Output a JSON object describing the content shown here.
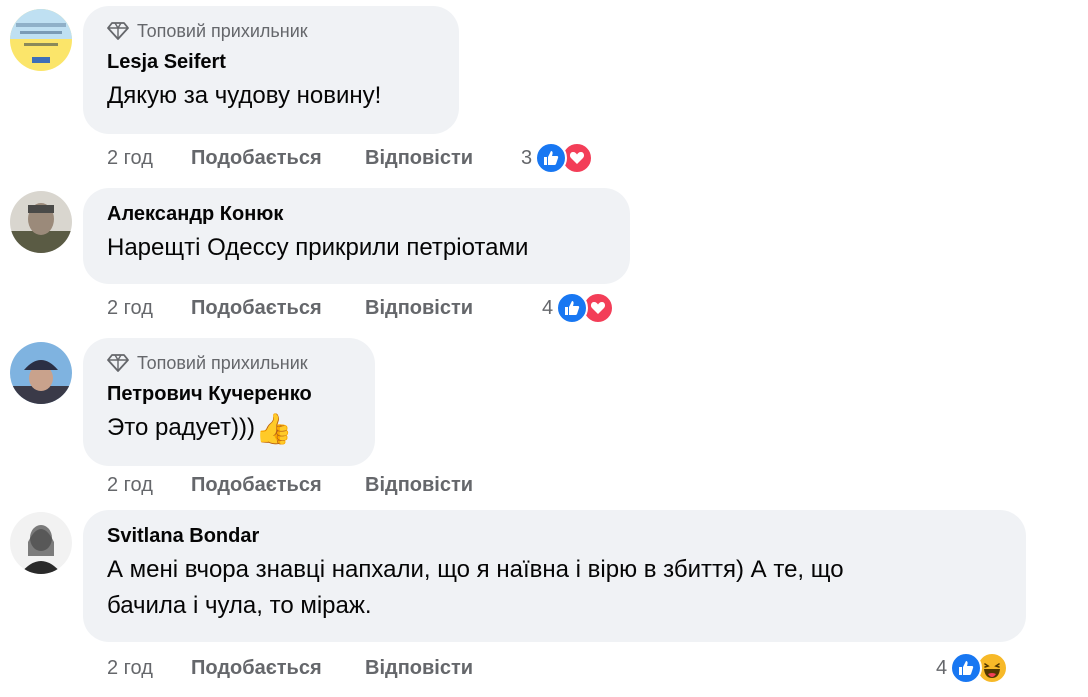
{
  "comments": [
    {
      "badge": "Топовий прихильник",
      "author": "Lesja Seifert",
      "text": "Дякую за чудову новину!",
      "time": "2 год",
      "like_label": "Подобається",
      "reply_label": "Відповісти",
      "reaction_count": "3",
      "reactions": [
        "like",
        "love"
      ]
    },
    {
      "author": "Александр Конюк",
      "text": "Нарещті Одессу прикрили петріотами",
      "time": "2 год",
      "like_label": "Подобається",
      "reply_label": "Відповісти",
      "reaction_count": "4",
      "reactions": [
        "like",
        "love"
      ]
    },
    {
      "badge": "Топовий прихильник",
      "author": "Петрович Кучеренко",
      "text": "Это радует)))",
      "emoji": "👍",
      "time": "2 год",
      "like_label": "Подобається",
      "reply_label": "Відповісти"
    },
    {
      "author": "Svitlana Bondar",
      "text_line1": "А мені вчора знавці напхали, що я наївна і вірю в збиття) А те, що",
      "text_line2": "бачила і чула, то міраж.",
      "time": "2 год",
      "like_label": "Подобається",
      "reply_label": "Відповісти",
      "reaction_count": "4",
      "reactions": [
        "like",
        "haha"
      ]
    }
  ],
  "colors": {
    "bubble": "#f0f2f5",
    "meta_text": "#65676b",
    "like_blue": "#1877f2",
    "love_red": "#f33e58",
    "haha_yellow": "#f7b928"
  }
}
